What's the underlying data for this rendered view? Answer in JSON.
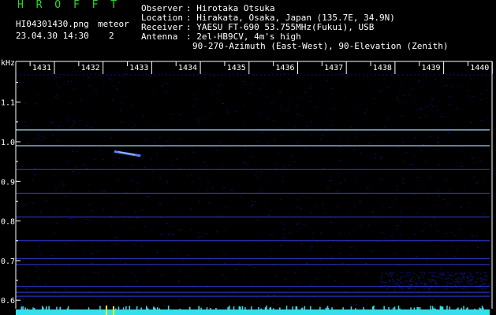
{
  "header": {
    "app_title": "H R O F F T",
    "file_name": "HI04301430.png",
    "datetime": "23.04.30 14:30",
    "meteor_label": "meteor",
    "meteor_count": "2"
  },
  "meta": {
    "keys": [
      "Observer",
      "Location",
      "Receiver",
      "Antenna"
    ],
    "observer": ": Hirotaka Otsuka",
    "location": ": Hirakata, Osaka, Japan (135.7E, 34.9N)",
    "receiver": ": YAESU FT-690 53.755MHz(Fukui), USB",
    "antenna": ": 2el-HB9CV, 4m's high",
    "antenna_line2": "90-270-Azimuth (East-West), 90-Elevation (Zenith)"
  },
  "chart_data": {
    "type": "heatmap",
    "ylabel": "kHz",
    "x_ticks": [
      "1431",
      "1432",
      "1433",
      "1434",
      "1435",
      "1436",
      "1437",
      "1438",
      "1439",
      "1440"
    ],
    "x_range": [
      1430.33,
      1440.0
    ],
    "y_ticks": [
      "1.1",
      "1.0",
      "0.9",
      "0.8",
      "0.7",
      "0.6"
    ],
    "y_range": [
      0.58,
      1.16
    ],
    "carrier_lines_khz": [
      1.03,
      0.99,
      0.93,
      0.87,
      0.81,
      0.75,
      0.705,
      0.69,
      0.635,
      0.62,
      0.61
    ],
    "meteor_echo": {
      "x": [
        1432.25,
        1432.75
      ],
      "y": [
        0.975,
        0.965
      ]
    },
    "colors": {
      "background": "#000000",
      "carrier": "#3b46ff",
      "noise": "#12127a",
      "bright_line": "#9fd6ff",
      "spectrum_bar": "#35e0ea",
      "marker": "#ffff00"
    }
  }
}
